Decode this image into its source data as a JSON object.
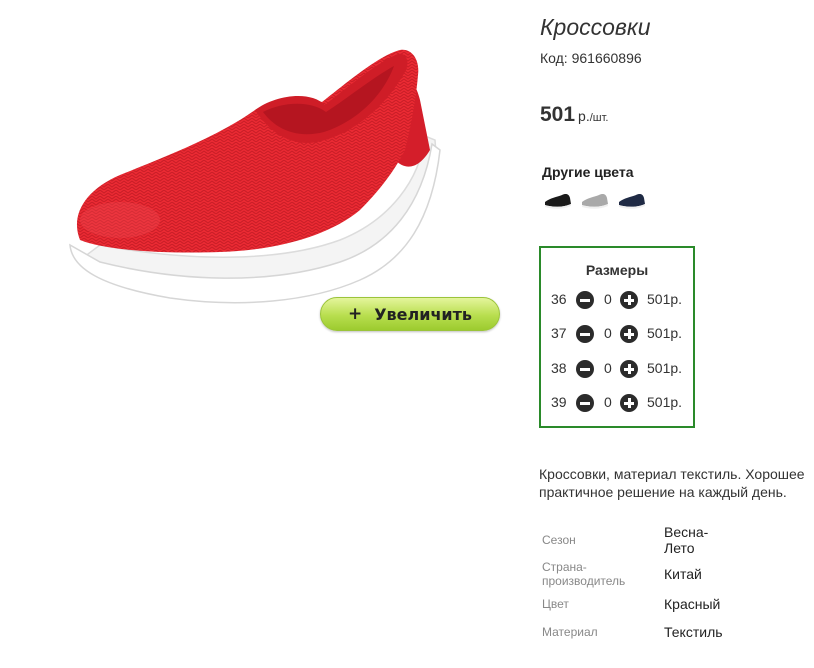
{
  "product": {
    "title": "Кроссовки",
    "code_label": "Код:",
    "code": "961660896",
    "price_value": "501",
    "price_currency": "р.",
    "price_unit": "/шт.",
    "zoom_button": "Увеличить",
    "zoom_icon": "+"
  },
  "other_colors": {
    "label": "Другие цвета",
    "swatches": [
      {
        "name": "black",
        "color": "#1a1a1a"
      },
      {
        "name": "gray",
        "color": "#a9a9a9"
      },
      {
        "name": "navy",
        "color": "#1f2a44"
      }
    ]
  },
  "sizes": {
    "title": "Размеры",
    "rows": [
      {
        "size": "36",
        "qty": "0",
        "price": "501р."
      },
      {
        "size": "37",
        "qty": "0",
        "price": "501р."
      },
      {
        "size": "38",
        "qty": "0",
        "price": "501р."
      },
      {
        "size": "39",
        "qty": "0",
        "price": "501р."
      }
    ]
  },
  "description": "Кроссовки, материал текстиль. Хорошее практичное решение на каждый день.",
  "specs": [
    {
      "key": "Сезон",
      "value": "Весна-Лето"
    },
    {
      "key": "Страна-производитель",
      "value": "Китай"
    },
    {
      "key": "Цвет",
      "value": "Красный"
    },
    {
      "key": "Материал",
      "value": "Текстиль"
    }
  ],
  "colors": {
    "accent_green_border": "#2a8a2a",
    "zoom_button_gradient": [
      "#e4f59c",
      "#9ccb2f"
    ],
    "shoe_red": "#e8262f"
  }
}
